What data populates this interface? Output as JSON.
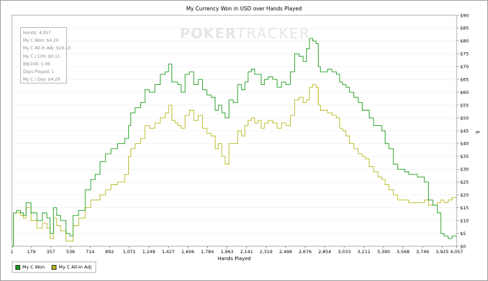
{
  "window": {
    "watermark_bold": "POKER",
    "watermark_thin": "TRACKER"
  },
  "stats": [
    "Hands: 4,057",
    "My C Won: $4.29",
    "My C All-In Adj: $19.10",
    "My C / 100: $0.11",
    "BB/100: 1.06",
    "Days Played: 1",
    "My C / Day: $4.29"
  ],
  "chart_data": {
    "type": "line",
    "title": "My Currency Won in USD over Hands Played",
    "xlabel": "Hands Played",
    "ylabel": "$",
    "xlim": [
      1,
      4057
    ],
    "ylim": [
      0,
      90
    ],
    "x_ticks": [
      "1",
      "179",
      "357",
      "536",
      "714",
      "892",
      "1,071",
      "1,249",
      "1,427",
      "1,606",
      "1,784",
      "1,963",
      "2,141",
      "2,319",
      "2,498",
      "2,676",
      "2,854",
      "3,033",
      "3,211",
      "3,390",
      "3,568",
      "3,746",
      "3,925",
      "4,057"
    ],
    "x_tick_values": [
      1,
      179,
      357,
      536,
      714,
      892,
      1071,
      1249,
      1427,
      1606,
      1784,
      1963,
      2141,
      2319,
      2498,
      2676,
      2854,
      3033,
      3211,
      3390,
      3568,
      3746,
      3925,
      4057
    ],
    "y_ticks": [
      "$0",
      "$5",
      "$10",
      "$15",
      "$20",
      "$25",
      "$30",
      "$35",
      "$40",
      "$45",
      "$50",
      "$55",
      "$60",
      "$65",
      "$70",
      "$75",
      "$80",
      "$85",
      "$90"
    ],
    "y_tick_values": [
      0,
      5,
      10,
      15,
      20,
      25,
      30,
      35,
      40,
      45,
      50,
      55,
      60,
      65,
      70,
      75,
      80,
      85,
      90
    ],
    "legend_position": "bottom-left",
    "series": [
      {
        "name": "My C Won",
        "color": "#1a9a1a",
        "x": [
          1,
          30,
          60,
          100,
          110,
          150,
          200,
          260,
          300,
          340,
          360,
          400,
          420,
          470,
          520,
          540,
          580,
          640,
          700,
          740,
          780,
          830,
          880,
          930,
          1000,
          1060,
          1071,
          1100,
          1150,
          1200,
          1230,
          1280,
          1330,
          1380,
          1420,
          1440,
          1480,
          1500,
          1530,
          1560,
          1600,
          1640,
          1680,
          1720,
          1760,
          1800,
          1840,
          1870,
          1900,
          1930,
          1963,
          2000,
          2040,
          2080,
          2110,
          2141,
          2170,
          2200,
          2230,
          2260,
          2290,
          2319,
          2360,
          2400,
          2440,
          2480,
          2520,
          2560,
          2600,
          2640,
          2676,
          2700,
          2730,
          2760,
          2790,
          2800,
          2830,
          2860,
          2900,
          2940,
          2980,
          3000,
          3033,
          3060,
          3100,
          3140,
          3180,
          3211,
          3240,
          3280,
          3320,
          3360,
          3390,
          3420,
          3460,
          3500,
          3540,
          3568,
          3600,
          3640,
          3680,
          3720,
          3746,
          3780,
          3820,
          3860,
          3900,
          3925,
          3960,
          4000,
          4030,
          4057
        ],
        "y": [
          0,
          13,
          14,
          13,
          12,
          17,
          13,
          10,
          13,
          11,
          5,
          15,
          12,
          10,
          5,
          4,
          12,
          14,
          22,
          26,
          28,
          33,
          36,
          38,
          40,
          42,
          47,
          52,
          54,
          56,
          61,
          60,
          63,
          67,
          68,
          71,
          64,
          64,
          63,
          60,
          67,
          68,
          63,
          65,
          61,
          59,
          58,
          53,
          55,
          52,
          50,
          57,
          56,
          63,
          61,
          64,
          68,
          69,
          67,
          67,
          63,
          65,
          66,
          65,
          62,
          64,
          63,
          68,
          75,
          74,
          72,
          77,
          81,
          80,
          79,
          70,
          68,
          68,
          69,
          68,
          67,
          64,
          63,
          62,
          60,
          58,
          56,
          53,
          53,
          50,
          47,
          47,
          45,
          40,
          38,
          32,
          30,
          30,
          29,
          28,
          28,
          27,
          27,
          25,
          18,
          16,
          13,
          5,
          4,
          3,
          4,
          4
        ],
        "interpolation": "step"
      },
      {
        "name": "My C All-In Adj",
        "color": "#b5b51a",
        "x": [
          1,
          30,
          60,
          100,
          110,
          150,
          200,
          260,
          300,
          340,
          360,
          400,
          420,
          470,
          520,
          540,
          580,
          640,
          700,
          740,
          780,
          830,
          880,
          930,
          1000,
          1060,
          1071,
          1100,
          1150,
          1200,
          1230,
          1280,
          1330,
          1380,
          1420,
          1440,
          1480,
          1500,
          1530,
          1560,
          1600,
          1640,
          1680,
          1720,
          1760,
          1800,
          1840,
          1870,
          1900,
          1930,
          1963,
          2000,
          2040,
          2080,
          2110,
          2141,
          2170,
          2200,
          2230,
          2260,
          2290,
          2319,
          2360,
          2400,
          2440,
          2480,
          2520,
          2560,
          2600,
          2640,
          2676,
          2700,
          2730,
          2760,
          2790,
          2800,
          2830,
          2860,
          2900,
          2940,
          2980,
          3000,
          3033,
          3060,
          3100,
          3140,
          3180,
          3211,
          3240,
          3280,
          3320,
          3360,
          3390,
          3420,
          3460,
          3500,
          3540,
          3568,
          3600,
          3640,
          3680,
          3720,
          3746,
          3780,
          3820,
          3860,
          3900,
          3925,
          3960,
          4000,
          4030,
          4057
        ],
        "y": [
          0,
          13,
          13,
          12,
          11,
          15,
          10,
          7,
          9,
          7,
          3,
          11,
          8,
          6,
          2,
          2,
          8,
          11,
          15,
          18,
          18,
          20,
          22,
          24,
          25,
          28,
          35,
          38,
          40,
          42,
          47,
          46,
          48,
          50,
          52,
          55,
          49,
          48,
          47,
          46,
          51,
          53,
          49,
          51,
          46,
          44,
          43,
          38,
          40,
          35,
          32,
          40,
          40,
          45,
          43,
          47,
          49,
          50,
          48,
          49,
          46,
          48,
          49,
          48,
          46,
          48,
          47,
          51,
          57,
          58,
          56,
          57,
          62,
          63,
          62,
          55,
          53,
          53,
          52,
          51,
          50,
          46,
          45,
          43,
          40,
          38,
          36,
          35,
          34,
          31,
          29,
          27,
          26,
          24,
          22,
          20,
          18,
          18,
          18,
          17,
          17,
          17,
          17,
          18,
          16,
          16,
          17,
          18,
          17,
          18,
          19,
          19
        ]
      }
    ]
  }
}
